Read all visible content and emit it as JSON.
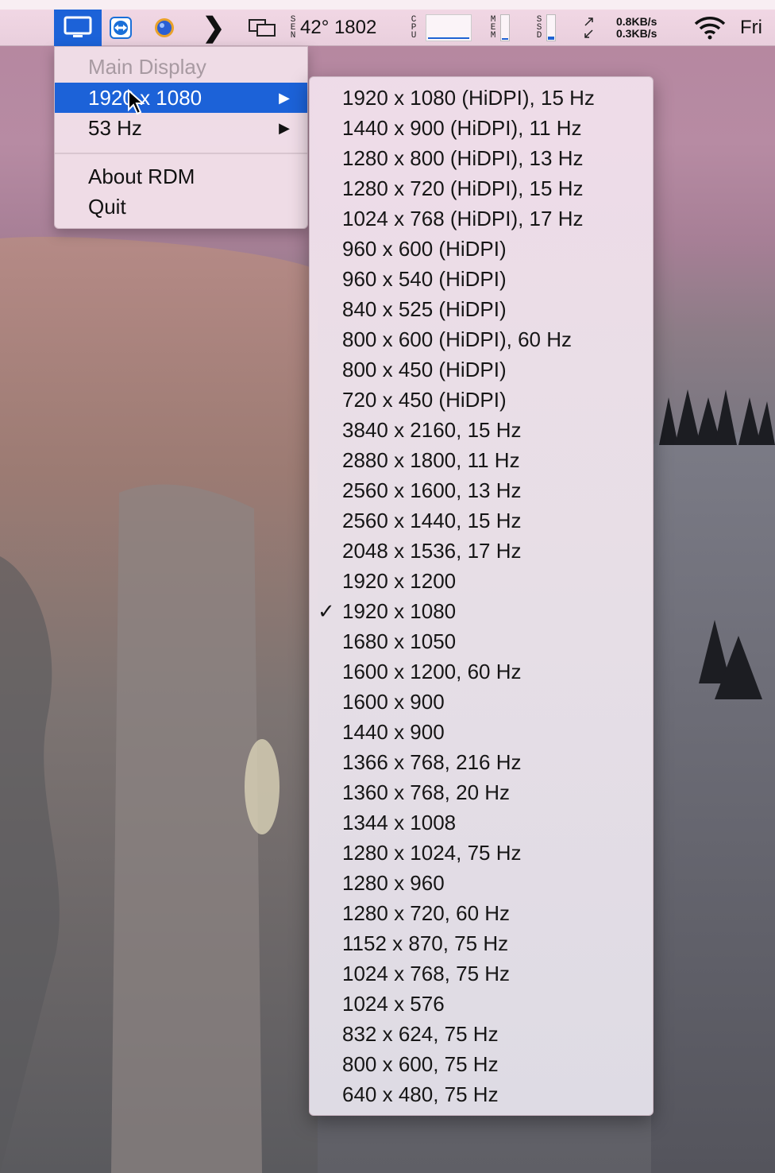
{
  "menubar": {
    "temperature": "42° 1802",
    "sensor_label": "SEN",
    "cpu_label": "CPU",
    "mem_label": "MEM",
    "ssd_label": "SSD",
    "net_up": "0.8KB/s",
    "net_down": "0.3KB/s",
    "clock": "Fri",
    "icons": [
      "display-icon",
      "teamviewer-icon",
      "globe-icon",
      "chevron-right-icon",
      "windows-icon",
      "network-arrows-icon",
      "wifi-icon"
    ]
  },
  "main_menu": {
    "header": "Main Display",
    "resolution": "1920 x 1080",
    "refresh": "53 Hz",
    "about": "About RDM",
    "quit": "Quit"
  },
  "submenu": {
    "checked_index": 17,
    "items": [
      "1920 x 1080 (HiDPI), 15 Hz",
      "1440 x 900 (HiDPI), 11 Hz",
      "1280 x 800 (HiDPI), 13 Hz",
      "1280 x 720 (HiDPI), 15 Hz",
      "1024 x 768 (HiDPI), 17 Hz",
      "960 x 600 (HiDPI)",
      "960 x 540 (HiDPI)",
      "840 x 525 (HiDPI)",
      "800 x 600 (HiDPI), 60 Hz",
      "800 x 450 (HiDPI)",
      "720 x 450 (HiDPI)",
      "3840 x 2160, 15 Hz",
      "2880 x 1800, 11 Hz",
      "2560 x 1600, 13 Hz",
      "2560 x 1440, 15 Hz",
      "2048 x 1536, 17 Hz",
      "1920 x 1200",
      "1920 x 1080",
      "1680 x 1050",
      "1600 x 1200, 60 Hz",
      "1600 x 900",
      "1440 x 900",
      "1366 x 768, 216 Hz",
      "1360 x 768, 20 Hz",
      "1344 x 1008",
      "1280 x 1024, 75 Hz",
      "1280 x 960",
      "1280 x 720, 60 Hz",
      "1152 x 870, 75 Hz",
      "1024 x 768, 75 Hz",
      "1024 x 576",
      "832 x 624, 75 Hz",
      "800 x 600, 75 Hz",
      "640 x 480, 75 Hz"
    ]
  },
  "colors": {
    "highlight": "#1c62d8",
    "menubar": "#efd5e2"
  }
}
